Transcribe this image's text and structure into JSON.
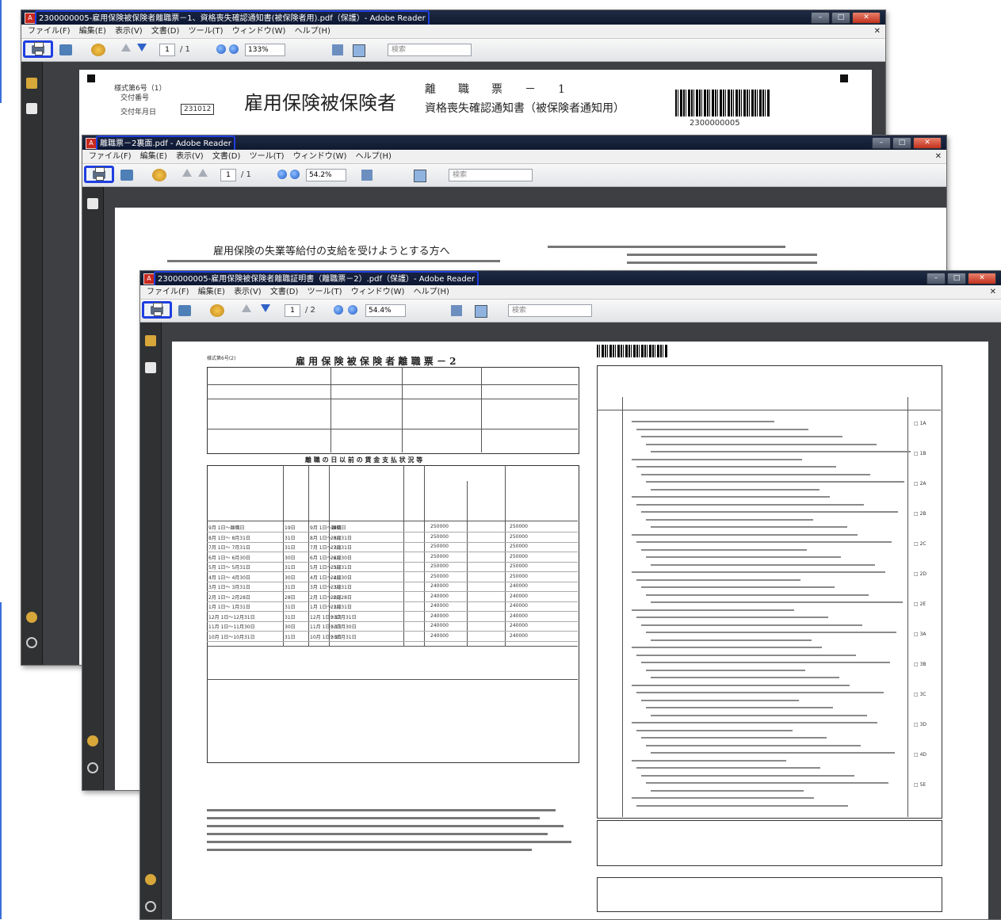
{
  "windows": [
    {
      "title": "2300000005-雇用保険被保険者離職票－1、資格喪失確認通知書(被保険者用).pdf（保護）- Adobe Reader",
      "menu": [
        "ファイル(F)",
        "編集(E)",
        "表示(V)",
        "文書(D)",
        "ツール(T)",
        "ウィンドウ(W)",
        "ヘルプ(H)"
      ],
      "page_current": "1",
      "page_total": "/ 1",
      "zoom": "133%",
      "search_placeholder": "検索",
      "doc": {
        "form_no": "様式第6号（1）",
        "issue_no_label": "交付番号",
        "issue_date_label": "交付年月日",
        "issue_date_value": "231012",
        "heading": "雇用保険被保険者",
        "subheading_top": "離　　職　　票　　－　　1",
        "subheading_bottom": "資格喪失確認通知書（被保険者通知用）",
        "barcode_number": "2300000005"
      }
    },
    {
      "title": "離職票－2裏面.pdf - Adobe Reader",
      "menu": [
        "ファイル(F)",
        "編集(E)",
        "表示(V)",
        "文書(D)",
        "ツール(T)",
        "ウィンドウ(W)",
        "ヘルプ(H)"
      ],
      "page_current": "1",
      "page_total": "/ 1",
      "zoom": "54.2%",
      "search_placeholder": "検索",
      "doc": {
        "heading": "雇用保険の失業等給付の支給を受けようとする方へ"
      }
    },
    {
      "title": "2300000005-雇用保険被保険者離職証明書（離職票－2）.pdf（保護）- Adobe Reader",
      "menu": [
        "ファイル(F)",
        "編集(E)",
        "表示(V)",
        "文書(D)",
        "ツール(T)",
        "ウィンドウ(W)",
        "ヘルプ(H)"
      ],
      "page_current": "1",
      "page_total": "/ 2",
      "zoom": "54.4%",
      "search_placeholder": "検索",
      "doc": {
        "form_no": "様式第6号(2)",
        "heading": "雇 用 保 険 被 保 険 者 離 職 票 － 2",
        "wage_heading": "離 職 の 日 以 前 の 賃 金 支 払 状 況 等",
        "wage_rows": [
          [
            "9月 1日～離職日",
            "19日",
            "9月 1日～離職日",
            "19日",
            "250000",
            "250000"
          ],
          [
            "8月 1日～ 8月31日",
            "31日",
            "8月 1日～ 8月31日",
            "23日",
            "250000",
            "250000"
          ],
          [
            "7月 1日～ 7月31日",
            "31日",
            "7月 1日～ 7月31日",
            "23日",
            "250000",
            "250000"
          ],
          [
            "6月 1日～ 6月30日",
            "30日",
            "6月 1日～ 6月30日",
            "22日",
            "250000",
            "250000"
          ],
          [
            "5月 1日～ 5月31日",
            "31日",
            "5月 1日～ 5月31日",
            "23日",
            "250000",
            "250000"
          ],
          [
            "4月 1日～ 4月30日",
            "30日",
            "4月 1日～ 4月30日",
            "22日",
            "250000",
            "250000"
          ],
          [
            "3月 1日～ 3月31日",
            "31日",
            "3月 1日～ 3月31日",
            "23日",
            "240000",
            "240000"
          ],
          [
            "2月 1日～ 2月28日",
            "28日",
            "2月 1日～ 2月28日",
            "20日",
            "240000",
            "240000"
          ],
          [
            "1月 1日～ 1月31日",
            "31日",
            "1月 1日～ 1月31日",
            "23日",
            "240000",
            "240000"
          ],
          [
            "12月 1日～12月31日",
            "31日",
            "12月 1日～12月31日",
            "23日",
            "240000",
            "240000"
          ],
          [
            "11月 1日～11月30日",
            "30日",
            "11月 1日～11月30日",
            "22日",
            "240000",
            "240000"
          ],
          [
            "10月 1日～10月31日",
            "31日",
            "10月 1日～10月31日",
            "23日",
            "240000",
            "240000"
          ]
        ],
        "reason_codes": [
          "1A",
          "1B",
          "2A",
          "2B",
          "2C",
          "2D",
          "2E",
          "3A",
          "3B",
          "3C",
          "3D",
          "4D",
          "5E"
        ]
      }
    }
  ],
  "highlight_color": "#1f3fe0"
}
